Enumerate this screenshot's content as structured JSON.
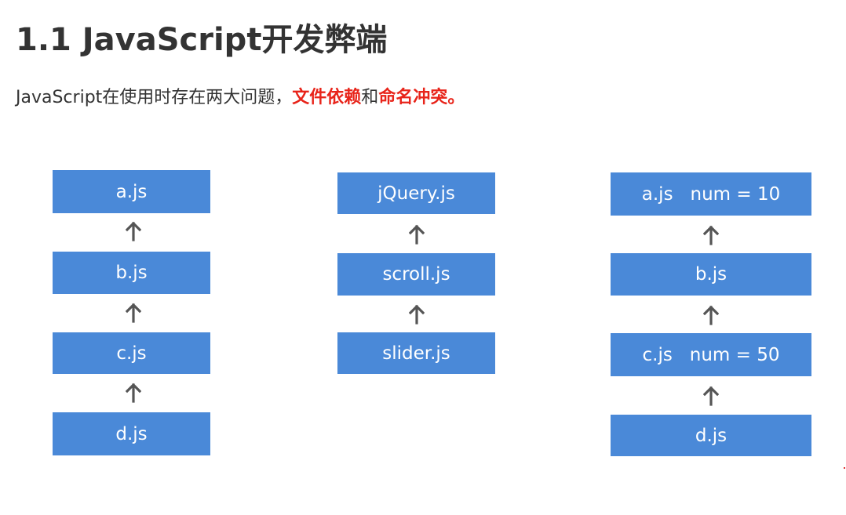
{
  "title": "1.1 JavaScript开发弊端",
  "subtitle": {
    "prefix": "JavaScript在使用时存在两大问题，",
    "highlight1": "文件依赖",
    "middle": "和",
    "highlight2": "命名冲突。"
  },
  "colors": {
    "box": "#4a89d8",
    "highlight": "#e8241a",
    "arrow": "#555555"
  },
  "diagram1": {
    "boxes": [
      "a.js",
      "b.js",
      "c.js",
      "d.js"
    ]
  },
  "diagram2": {
    "boxes": [
      "jQuery.js",
      "scroll.js",
      "slider.js"
    ]
  },
  "diagram3": {
    "boxes": [
      "a.js   num = 10",
      "b.js",
      "c.js   num = 50",
      "d.js"
    ]
  },
  "arrow_icon": "arrow-up-icon"
}
